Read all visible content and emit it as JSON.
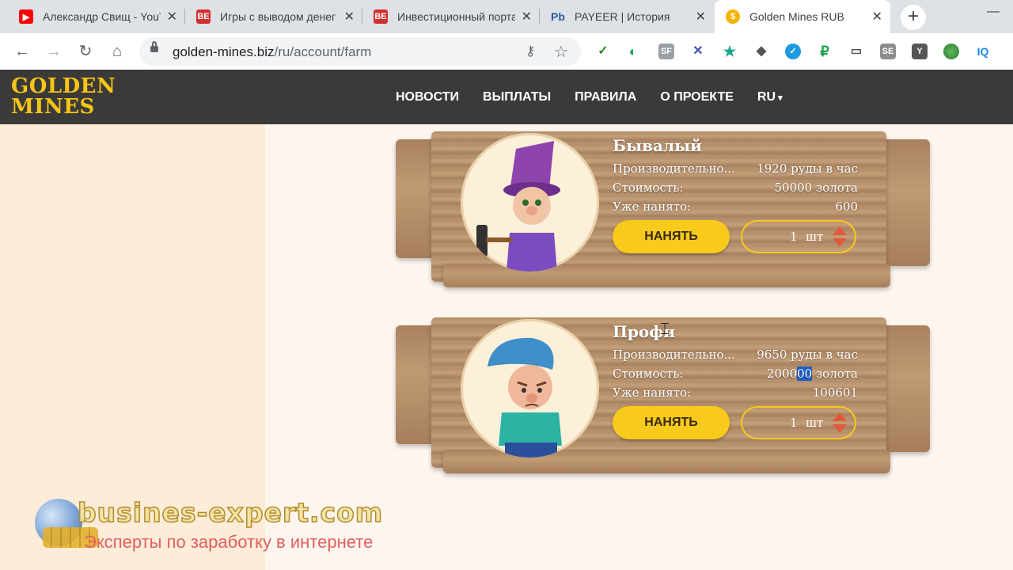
{
  "browser": {
    "tabs": [
      {
        "title": "Александр Свищ - YouTube",
        "favicon": "youtube-icon",
        "color": "#ff0000"
      },
      {
        "title": "Игры с выводом денег",
        "favicon": "be-icon",
        "color": "#d32f2f"
      },
      {
        "title": "Инвестиционный портал",
        "favicon": "be-icon",
        "color": "#d32f2f"
      },
      {
        "title": "PAYEER | История",
        "favicon": "payeer-icon",
        "color": "#2a5aa6"
      },
      {
        "title": "Golden Mines RUB",
        "favicon": "coin-icon",
        "color": "#f5b400"
      }
    ],
    "url_domain": "golden-mines.biz",
    "url_path": "/ru/account/farm"
  },
  "site": {
    "logo": {
      "line1": "GOLDEN",
      "line2": "MINES"
    },
    "nav": [
      "НОВОСТИ",
      "ВЫПЛАТЫ",
      "ПРАВИЛА",
      "О ПРОЕКТЕ",
      "RU"
    ]
  },
  "cards": [
    {
      "name": "Бывалый",
      "rows": [
        {
          "label": "Производительно...",
          "value": "1920 руды в час"
        },
        {
          "label": "Стоимость:",
          "value": "50000 золота"
        },
        {
          "label": "Уже нанято:",
          "value": "600"
        }
      ],
      "hire_label": "НАНЯТЬ",
      "qty": "1",
      "qty_unit": "шт",
      "hat_color": "#8e44ad",
      "shirt_color": "#7b4bc0"
    },
    {
      "name": "Профи",
      "rows": [
        {
          "label": "Производительно...",
          "value": "9650 руды в час"
        },
        {
          "label": "Стоимость:",
          "value_pre": "2000",
          "value_sel": "00",
          "value_post": " золота"
        },
        {
          "label": "Уже нанято:",
          "value": "100601"
        }
      ],
      "hire_label": "НАНЯТЬ",
      "qty": "1",
      "qty_unit": "шт",
      "hat_color": "#3f8fc9",
      "shirt_color": "#2bb3a3"
    }
  ],
  "watermark": {
    "site": "busines-expert.com",
    "tagline": "Эксперты по заработку в интернете"
  }
}
